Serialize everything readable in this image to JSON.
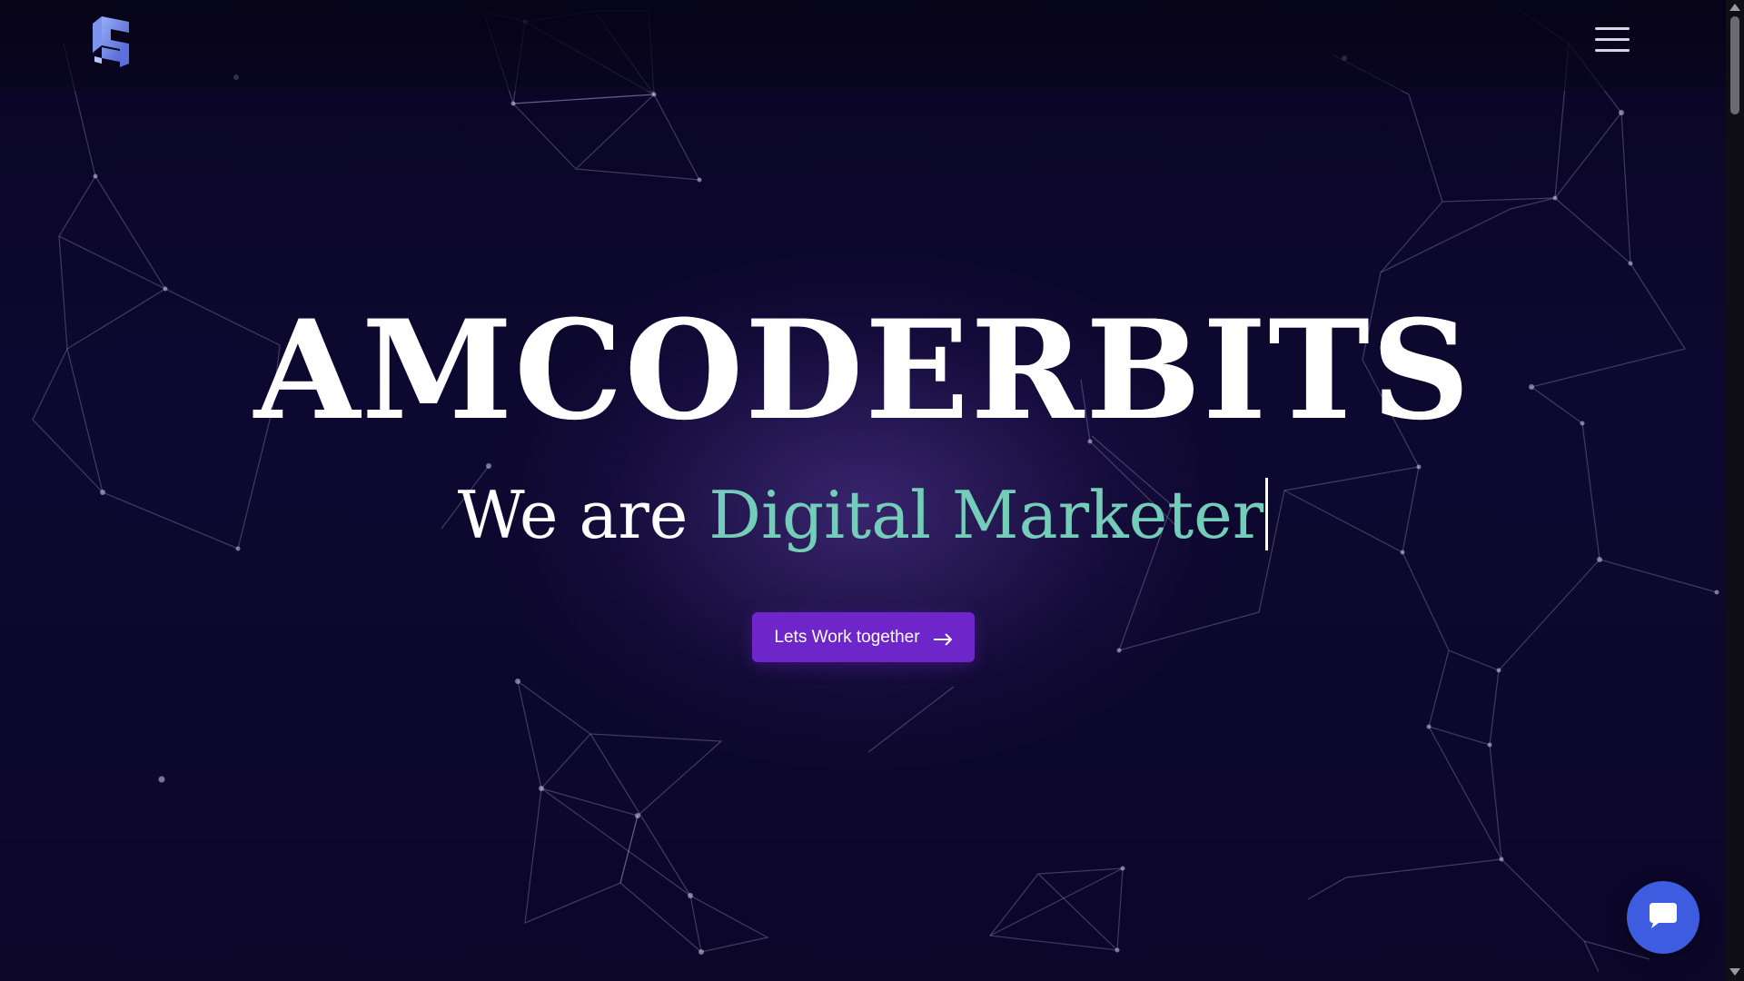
{
  "brand": {
    "logo_icon": "amcoderbits-logo-icon"
  },
  "header": {
    "menu_icon": "hamburger-menu-icon"
  },
  "hero": {
    "title": "AMCODERBITS",
    "subtitle_lead": "We are",
    "subtitle_typed": "Digital Marketer",
    "cta_label": "Lets Work together",
    "cta_icon": "arrow-right-icon"
  },
  "chat": {
    "icon": "chat-bubble-icon"
  },
  "colors": {
    "background": "#0b0726",
    "accent_teal": "#74cdb9",
    "cta_purple": "#6e25c9",
    "chat_blue": "#3d5ce0"
  }
}
